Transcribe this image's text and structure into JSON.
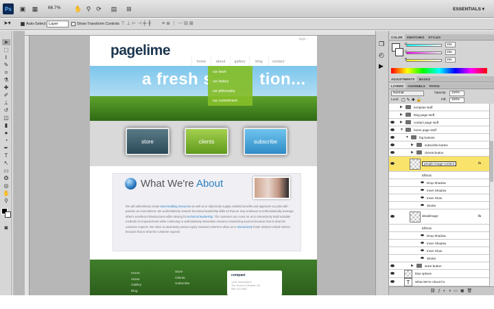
{
  "app": {
    "logo": "Ps",
    "zoom": "66.7%",
    "workspace": "ESSENTIALS ▾"
  },
  "options": {
    "auto_select_label": "Auto-Select:",
    "auto_select_target": "Layer",
    "transform_controls_label": "Show Transform Controls"
  },
  "site": {
    "logo": "pagelime",
    "login": "login ›",
    "nav": [
      "home",
      "about",
      "gallery",
      "blog",
      "contact"
    ],
    "dropdown": [
      "our team",
      "our history",
      "our philosophy",
      "our commitment"
    ],
    "headline": "a fresh s",
    "headline_end": "tion...",
    "buttons": {
      "store": "store",
      "clients": "clients",
      "subscribe": "subscribe"
    },
    "about_title_a": "What We're ",
    "about_title_b": "About",
    "about_body_1": "We will authoritively create ",
    "about_link_1": "team building resources",
    "about_body_2": " as well as to objectively supply enabled benefits and approach our jobs with passion an commitment. We authoritatively network functional leadership skills so that we may endeavor to enthusiastically leverage other's excellent infrastructures while striving for ",
    "about_link_2": "technical leadership",
    "about_body_3": ". The customer can count on us to interactively build scalable methods of empowerment while continuing to authoritatively streamline resource maximizing sources because that is what the customer expects. We strive to assertively pursue equity invested content to allow us to ",
    "about_link_3": "interactively",
    "about_body_4": " foster mission-critical metrics because that is what the customer expects.",
    "footer_col1": [
      "Home",
      "About",
      "Gallery",
      "Blog"
    ],
    "footer_col2": [
      "Store",
      "Clients",
      "Subscribe"
    ],
    "footer_box_title": "compani",
    "footer_box_lines": [
      "1234 Somewhere",
      "The Grove in Streete, 5A",
      "555 123 4567"
    ]
  },
  "color_panel": {
    "tabs": [
      "COLOR",
      "SWATCHES",
      "STYLES"
    ],
    "r": "255",
    "g": "255",
    "b": "255",
    "labels": [
      "R",
      "G",
      "B"
    ]
  },
  "adjust_tabs": [
    "ADJUSTMENTS",
    "MASKS"
  ],
  "layers_panel": {
    "tabs": [
      "LAYERS",
      "CHANNELS",
      "PATHS"
    ],
    "blend_mode": "Normal",
    "opacity_label": "Opacity:",
    "opacity": "100%",
    "lock_label": "Lock:",
    "fill_label": "Fill:",
    "fill": "100%",
    "layers": [
      {
        "name": "template stuff"
      },
      {
        "name": "blog page stuff"
      },
      {
        "name": "contact page stuff"
      },
      {
        "name": "home page stuff"
      },
      {
        "name": "big buttons"
      },
      {
        "name": "subscribe-button"
      },
      {
        "name": "clients-button"
      },
      {
        "name": "people image-content"
      },
      {
        "name": "Effects"
      },
      {
        "name": "Drop Shadow"
      },
      {
        "name": "Inner Shadow"
      },
      {
        "name": "Inner Glow"
      },
      {
        "name": "Stroke"
      },
      {
        "name": "detailimage"
      },
      {
        "name": "Effects"
      },
      {
        "name": "Drop Shadow"
      },
      {
        "name": "Inner Shadow"
      },
      {
        "name": "Inner Glow"
      },
      {
        "name": "Stroke"
      },
      {
        "name": "store-button"
      },
      {
        "name": "blue sphere"
      },
      {
        "name": "What We're About-h1"
      }
    ],
    "fx": "fx"
  }
}
